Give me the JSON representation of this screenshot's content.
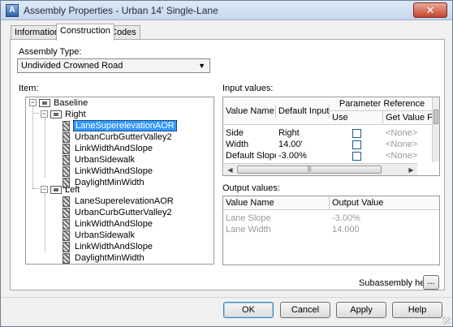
{
  "window": {
    "title": "Assembly Properties - Urban 14' Single-Lane",
    "app_icon_glyph": "A",
    "close_glyph": "✕"
  },
  "tabs": [
    "Information",
    "Construction",
    "Codes"
  ],
  "assembly_type": {
    "label": "Assembly Type:",
    "value": "Undivided Crowned Road"
  },
  "item_label": "Item:",
  "tree": {
    "root": "Baseline",
    "right": {
      "label": "Right",
      "items": [
        "LaneSuperelevationAOR",
        "UrbanCurbGutterValley2",
        "LinkWidthAndSlope",
        "UrbanSidewalk",
        "LinkWidthAndSlope",
        "DaylightMinWidth"
      ],
      "selected": 0
    },
    "left": {
      "label": "Left",
      "items": [
        "LaneSuperelevationAOR",
        "UrbanCurbGutterValley2",
        "LinkWidthAndSlope",
        "UrbanSidewalk",
        "LinkWidthAndSlope",
        "DaylightMinWidth"
      ]
    }
  },
  "input_values": {
    "label": "Input values:",
    "group_header": "Parameter Reference",
    "columns": [
      "Value Name",
      "Default Input...",
      "Use",
      "Get Value Fr"
    ],
    "rows": [
      {
        "name": "Side",
        "default": "Right",
        "ref": "<None>"
      },
      {
        "name": "Width",
        "default": "14.00'",
        "ref": "<None>"
      },
      {
        "name": "Default Slope",
        "default": "-3.00%",
        "ref": "<None>"
      }
    ],
    "scroll_thumb_glyph": "|||"
  },
  "output_values": {
    "label": "Output values:",
    "columns": [
      "Value Name",
      "Output Value"
    ],
    "rows": [
      {
        "name": "Lane Slope",
        "value": "-3.00%"
      },
      {
        "name": "Lane Width",
        "value": "14.000"
      }
    ]
  },
  "subassembly_help": {
    "label": "Subassembly help:",
    "button": "..."
  },
  "buttons": {
    "ok": "OK",
    "cancel": "Cancel",
    "apply": "Apply",
    "help": "Help"
  },
  "colors": {
    "selection": "#3399ff",
    "checkbox_border": "#1b5b96"
  }
}
